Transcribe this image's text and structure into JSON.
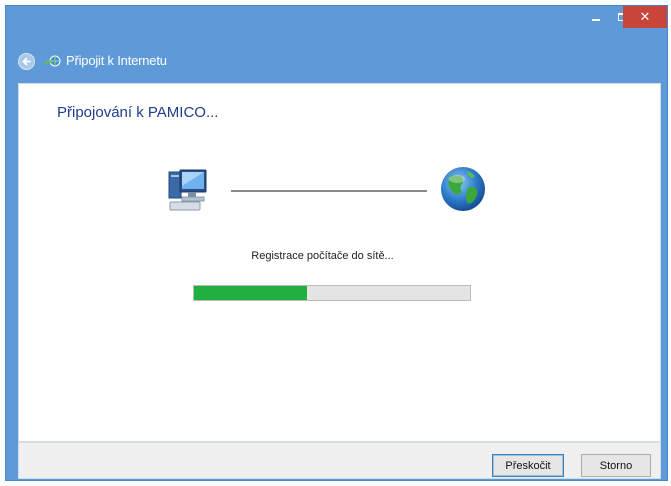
{
  "window": {
    "title": "Připojit k Internetu",
    "close_glyph": "✕"
  },
  "main": {
    "heading": "Připojování k PAMICO...",
    "status": "Registrace počítače do sítě..."
  },
  "progress": {
    "value": 0.41
  },
  "footer": {
    "skip_label": "Přeskočit",
    "cancel_label": "Storno"
  },
  "colors": {
    "title_bar": "#5e9ad8",
    "close_button": "#c7453a",
    "progress_fill": "#21b040",
    "heading": "#1e3d8f"
  },
  "icons": [
    "back-arrow-icon",
    "network-icon",
    "computer-icon",
    "globe-icon"
  ]
}
